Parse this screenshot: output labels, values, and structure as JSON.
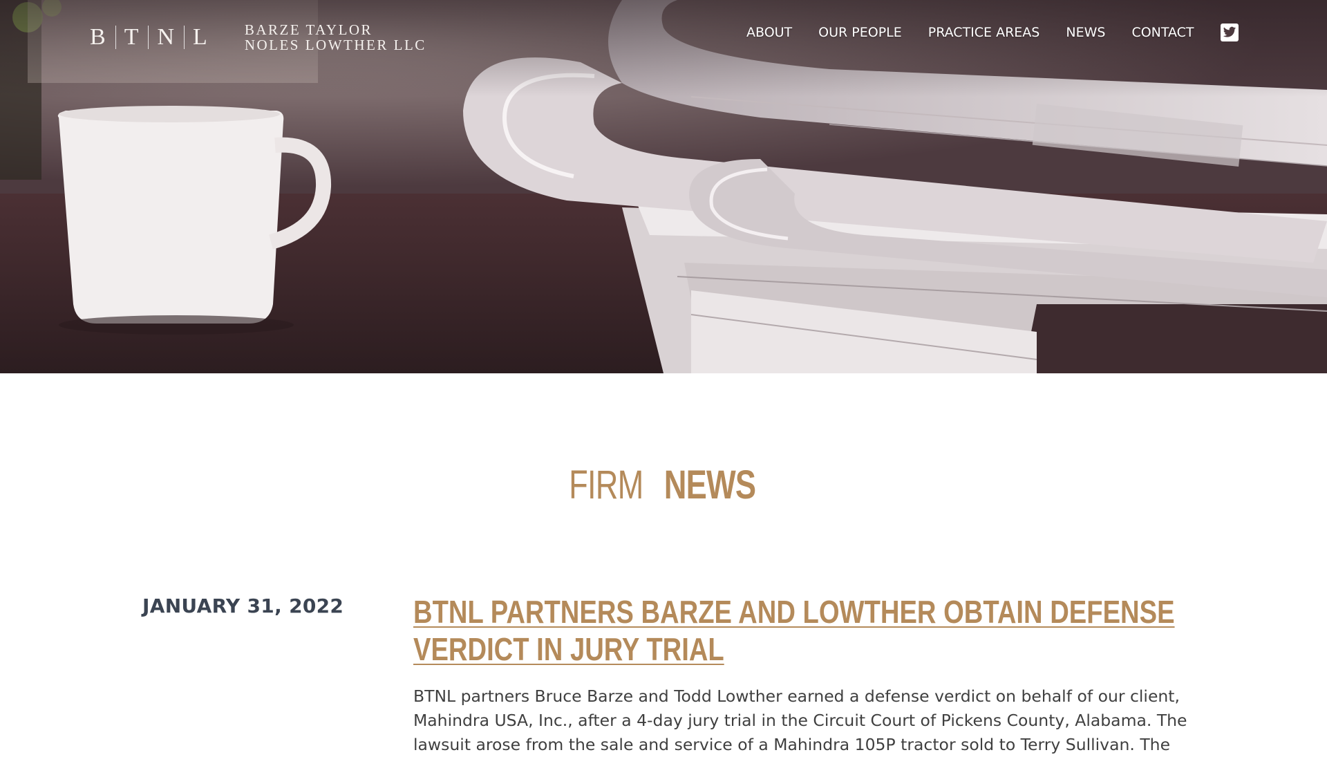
{
  "header": {
    "logo": {
      "letters": [
        "B",
        "T",
        "N",
        "L"
      ],
      "name_line1": "BARZE  TAYLOR",
      "name_line2": "NOLES  LOWTHER  LLC"
    },
    "nav": [
      {
        "label": "ABOUT"
      },
      {
        "label": "OUR PEOPLE"
      },
      {
        "label": "PRACTICE AREAS"
      },
      {
        "label": "NEWS"
      },
      {
        "label": "CONTACT"
      }
    ],
    "social_icon": "twitter-icon"
  },
  "hero": {
    "image": "magazines-and-coffee-cup-photo"
  },
  "main": {
    "section_title_light": "FIRM",
    "section_title_bold": "NEWS",
    "posts": [
      {
        "date": "JANUARY 31, 2022",
        "title": "BTNL PARTNERS BARZE AND LOWTHER OBTAIN DEFENSE VERDICT IN JURY TRIAL",
        "excerpt": "BTNL partners Bruce Barze and Todd Lowther earned a defense verdict on behalf of our client, Mahindra USA, Inc., after a 4-day jury trial in the Circuit Court of Pickens County, Alabama. The lawsuit arose from the sale and service of a Mahindra 105P tractor sold to Terry Sullivan. The"
      }
    ]
  },
  "colors": {
    "accent": "#b48a5a",
    "date_text": "#3b4452",
    "body_text": "#3f3f3f"
  }
}
